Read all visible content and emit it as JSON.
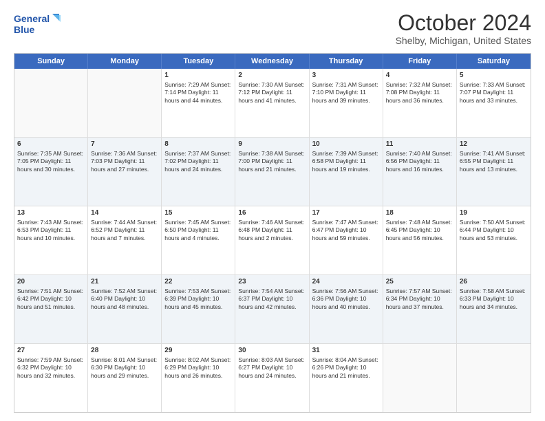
{
  "header": {
    "logo_line1": "General",
    "logo_line2": "Blue",
    "title": "October 2024",
    "subtitle": "Shelby, Michigan, United States"
  },
  "days": [
    "Sunday",
    "Monday",
    "Tuesday",
    "Wednesday",
    "Thursday",
    "Friday",
    "Saturday"
  ],
  "weeks": [
    [
      {
        "day": "",
        "info": ""
      },
      {
        "day": "",
        "info": ""
      },
      {
        "day": "1",
        "info": "Sunrise: 7:29 AM\nSunset: 7:14 PM\nDaylight: 11 hours and 44 minutes."
      },
      {
        "day": "2",
        "info": "Sunrise: 7:30 AM\nSunset: 7:12 PM\nDaylight: 11 hours and 41 minutes."
      },
      {
        "day": "3",
        "info": "Sunrise: 7:31 AM\nSunset: 7:10 PM\nDaylight: 11 hours and 39 minutes."
      },
      {
        "day": "4",
        "info": "Sunrise: 7:32 AM\nSunset: 7:08 PM\nDaylight: 11 hours and 36 minutes."
      },
      {
        "day": "5",
        "info": "Sunrise: 7:33 AM\nSunset: 7:07 PM\nDaylight: 11 hours and 33 minutes."
      }
    ],
    [
      {
        "day": "6",
        "info": "Sunrise: 7:35 AM\nSunset: 7:05 PM\nDaylight: 11 hours and 30 minutes."
      },
      {
        "day": "7",
        "info": "Sunrise: 7:36 AM\nSunset: 7:03 PM\nDaylight: 11 hours and 27 minutes."
      },
      {
        "day": "8",
        "info": "Sunrise: 7:37 AM\nSunset: 7:02 PM\nDaylight: 11 hours and 24 minutes."
      },
      {
        "day": "9",
        "info": "Sunrise: 7:38 AM\nSunset: 7:00 PM\nDaylight: 11 hours and 21 minutes."
      },
      {
        "day": "10",
        "info": "Sunrise: 7:39 AM\nSunset: 6:58 PM\nDaylight: 11 hours and 19 minutes."
      },
      {
        "day": "11",
        "info": "Sunrise: 7:40 AM\nSunset: 6:56 PM\nDaylight: 11 hours and 16 minutes."
      },
      {
        "day": "12",
        "info": "Sunrise: 7:41 AM\nSunset: 6:55 PM\nDaylight: 11 hours and 13 minutes."
      }
    ],
    [
      {
        "day": "13",
        "info": "Sunrise: 7:43 AM\nSunset: 6:53 PM\nDaylight: 11 hours and 10 minutes."
      },
      {
        "day": "14",
        "info": "Sunrise: 7:44 AM\nSunset: 6:52 PM\nDaylight: 11 hours and 7 minutes."
      },
      {
        "day": "15",
        "info": "Sunrise: 7:45 AM\nSunset: 6:50 PM\nDaylight: 11 hours and 4 minutes."
      },
      {
        "day": "16",
        "info": "Sunrise: 7:46 AM\nSunset: 6:48 PM\nDaylight: 11 hours and 2 minutes."
      },
      {
        "day": "17",
        "info": "Sunrise: 7:47 AM\nSunset: 6:47 PM\nDaylight: 10 hours and 59 minutes."
      },
      {
        "day": "18",
        "info": "Sunrise: 7:48 AM\nSunset: 6:45 PM\nDaylight: 10 hours and 56 minutes."
      },
      {
        "day": "19",
        "info": "Sunrise: 7:50 AM\nSunset: 6:44 PM\nDaylight: 10 hours and 53 minutes."
      }
    ],
    [
      {
        "day": "20",
        "info": "Sunrise: 7:51 AM\nSunset: 6:42 PM\nDaylight: 10 hours and 51 minutes."
      },
      {
        "day": "21",
        "info": "Sunrise: 7:52 AM\nSunset: 6:40 PM\nDaylight: 10 hours and 48 minutes."
      },
      {
        "day": "22",
        "info": "Sunrise: 7:53 AM\nSunset: 6:39 PM\nDaylight: 10 hours and 45 minutes."
      },
      {
        "day": "23",
        "info": "Sunrise: 7:54 AM\nSunset: 6:37 PM\nDaylight: 10 hours and 42 minutes."
      },
      {
        "day": "24",
        "info": "Sunrise: 7:56 AM\nSunset: 6:36 PM\nDaylight: 10 hours and 40 minutes."
      },
      {
        "day": "25",
        "info": "Sunrise: 7:57 AM\nSunset: 6:34 PM\nDaylight: 10 hours and 37 minutes."
      },
      {
        "day": "26",
        "info": "Sunrise: 7:58 AM\nSunset: 6:33 PM\nDaylight: 10 hours and 34 minutes."
      }
    ],
    [
      {
        "day": "27",
        "info": "Sunrise: 7:59 AM\nSunset: 6:32 PM\nDaylight: 10 hours and 32 minutes."
      },
      {
        "day": "28",
        "info": "Sunrise: 8:01 AM\nSunset: 6:30 PM\nDaylight: 10 hours and 29 minutes."
      },
      {
        "day": "29",
        "info": "Sunrise: 8:02 AM\nSunset: 6:29 PM\nDaylight: 10 hours and 26 minutes."
      },
      {
        "day": "30",
        "info": "Sunrise: 8:03 AM\nSunset: 6:27 PM\nDaylight: 10 hours and 24 minutes."
      },
      {
        "day": "31",
        "info": "Sunrise: 8:04 AM\nSunset: 6:26 PM\nDaylight: 10 hours and 21 minutes."
      },
      {
        "day": "",
        "info": ""
      },
      {
        "day": "",
        "info": ""
      }
    ]
  ]
}
